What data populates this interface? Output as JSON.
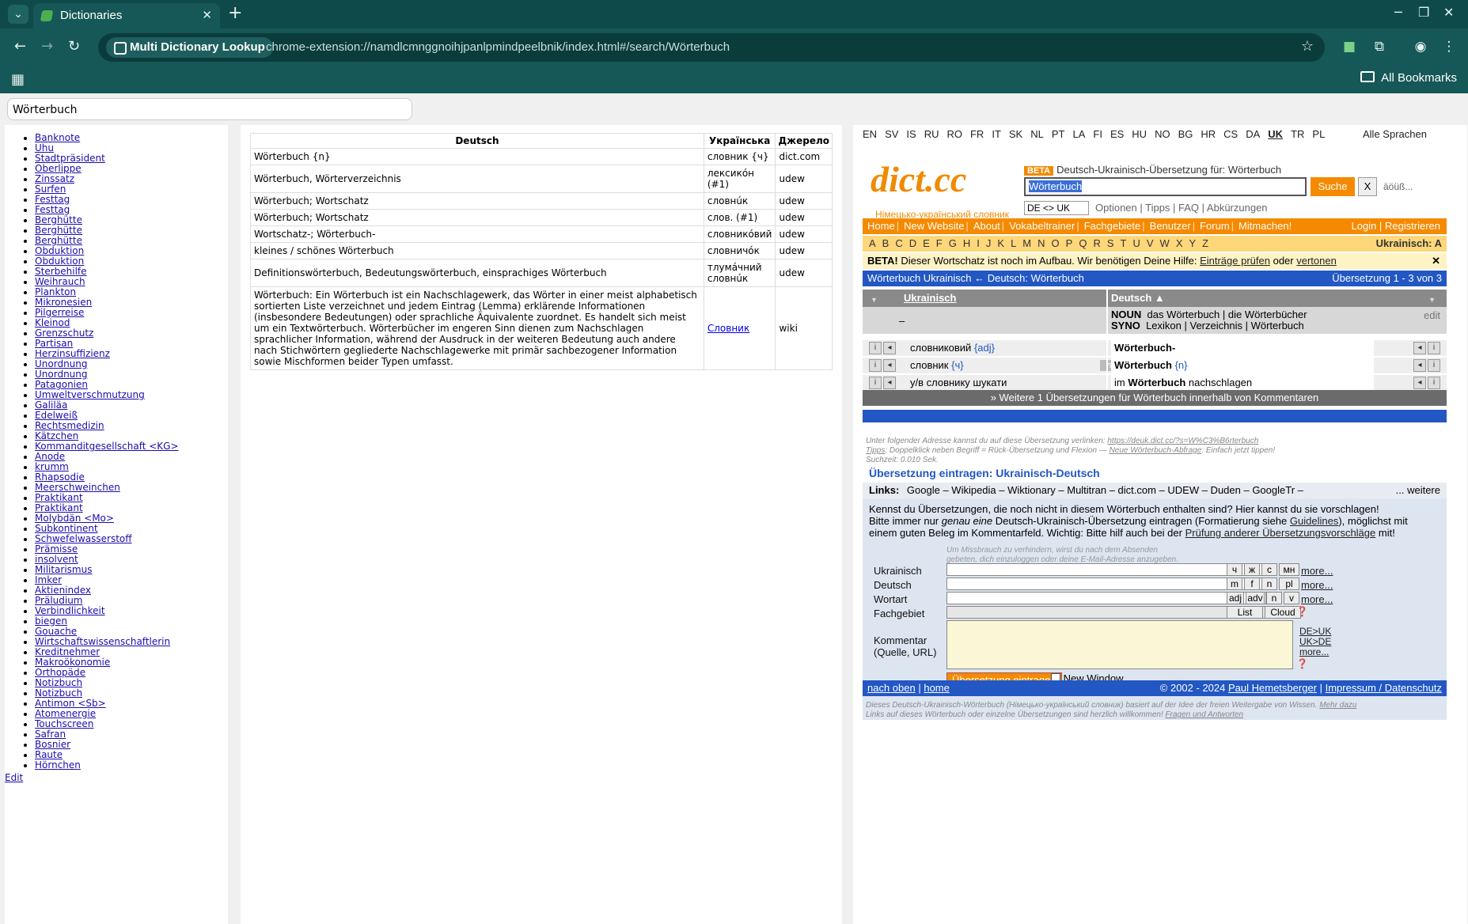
{
  "browser": {
    "tab_title": "Dictionaries",
    "site_name": "Multi Dictionary Lookup",
    "url": "chrome-extension://namdlcmnggnoihjpanlpmindpeelbnik/index.html#/search/Wörterbuch",
    "all_bookmarks": "All Bookmarks"
  },
  "search": {
    "value": "Wörterbuch"
  },
  "history": [
    "Banknote",
    "Uhu",
    "Stadtpräsident",
    "Oberlippe",
    "Zinssatz",
    "Surfen",
    "Festtag",
    "Festtag",
    "Berghütte",
    "Berghütte",
    "Berghütte",
    "Obduktion",
    "Obduktion",
    "Sterbehilfe",
    "Weihrauch",
    "Plankton",
    "Mikronesien",
    "Pilgerreise",
    "Kleinod",
    "Grenzschutz",
    "Partisan",
    "Herzinsuffizienz",
    "Unordnung",
    "Unordnung",
    "Patagonien",
    "Umweltverschmutzung",
    "Galiläa",
    "Edelweiß",
    "Rechtsmedizin",
    "Kätzchen",
    "Kommanditgesellschaft <KG>",
    "Anode",
    "krumm",
    "Rhapsodie",
    "Meerschweinchen",
    "Praktikant",
    "Praktikant",
    "Molybdän <Mo>",
    "Subkontinent",
    "Schwefelwasserstoff",
    "Prämisse",
    "insolvent",
    "Militarismus",
    "Imker",
    "Aktienindex",
    "Präludium",
    "Verbindlichkeit",
    "biegen",
    "Gouache",
    "Wirtschaftswissenschaftlerin",
    "Kreditnehmer",
    "Makroökonomie",
    "Orthopäde",
    "Notizbuch",
    "Notizbuch",
    "Antimon <Sb>",
    "Atomenergie",
    "Touchscreen",
    "Safran",
    "Bosnier",
    "Raute",
    "Hörnchen"
  ],
  "edit_label": "Edit",
  "results": {
    "headers": [
      "Deutsch",
      "Українська",
      "Джерело"
    ],
    "rows": [
      {
        "de": "Wörterbuch {n}",
        "uk": "словник {ч}",
        "src": "dict.com"
      },
      {
        "de": "Wörterbuch, Wörterverzeichnis",
        "uk": "лексикóн (#1)",
        "src": "udew"
      },
      {
        "de": "Wörterbuch; Wortschatz",
        "uk": "словнúк",
        "src": "udew"
      },
      {
        "de": "Wörterbuch; Wortschatz",
        "uk": "слов. (#1)",
        "src": "udew"
      },
      {
        "de": "Wortschatz-; Wörterbuch-",
        "uk": "словникóвий",
        "src": "udew"
      },
      {
        "de": "kleines / schönes Wörterbuch",
        "uk": "словничóк",
        "src": "udew"
      },
      {
        "de": "Definitionswörterbuch, Bedeutungswörterbuch, einsprachiges Wörterbuch",
        "uk": "тлумáчний словнúк",
        "src": "udew"
      },
      {
        "de": "Wörterbuch: Ein Wörterbuch ist ein Nachschlagewerk, das Wörter in einer meist alphabetisch sortierten Liste verzeichnet und jedem Eintrag (Lemma) erklärende Informationen (insbesondere Bedeutungen) oder sprachliche Äquivalente zuordnet. Es handelt sich meist um ein Textwörterbuch. Wörterbücher im engeren Sinn dienen zum Nachschlagen sprachlicher Information, während der Ausdruck in der weiteren Bedeutung auch andere nach Stichwörtern gegliederte Nachschlagewerke mit primär sachbezogener Information sowie Mischformen beider Typen umfasst.",
        "uk": "Словник",
        "src": "wiki"
      }
    ]
  },
  "dictcc": {
    "languages": [
      "EN",
      "SV",
      "IS",
      "RU",
      "RO",
      "FR",
      "IT",
      "SK",
      "NL",
      "PT",
      "LA",
      "FI",
      "ES",
      "HU",
      "NO",
      "BG",
      "HR",
      "CS",
      "DA",
      "UK",
      "TR",
      "PL"
    ],
    "selected_language": "UK",
    "all_languages": "Alle Sprachen",
    "logo": "dict.cc",
    "logo_sub": "Німецько-український словник",
    "beta_badge": "BETA",
    "beta_title": "Deutsch-Ukrainisch-Übersetzung für: Wörterbuch",
    "query": "Wörterbuch",
    "search_button": "Suche",
    "clear_button": "X",
    "special_chars": "äöüß...",
    "lang_select": "DE <> UK",
    "option_links": "Optionen | Tipps | FAQ | Abkürzungen",
    "menu": [
      "Home",
      "New Website",
      "About",
      "Vokabeltrainer",
      "Fachgebiete",
      "Benutzer",
      "Forum",
      "Mitmachen!"
    ],
    "menu_right": "Login | Registrieren",
    "alphabet": [
      "A",
      "B",
      "C",
      "D",
      "E",
      "F",
      "G",
      "H",
      "I",
      "J",
      "K",
      "L",
      "M",
      "N",
      "O",
      "P",
      "Q",
      "R",
      "S",
      "T",
      "U",
      "V",
      "W",
      "X",
      "Y",
      "Z"
    ],
    "alphabet_right": "Ukrainisch: A",
    "beta_note_bold": "BETA!",
    "beta_note": "Dieser Wortschatz ist noch im Aufbau. Wir benötigen Deine Hilfe:",
    "beta_link1": "Einträge prüfen",
    "beta_or": "oder",
    "beta_link2": "vertonen",
    "result_left": "Wörterbuch Ukrainisch ← Deutsch: Wörterbuch",
    "result_right": "Übersetzung 1 - 3 von 3",
    "col_uk": "Ukrainisch",
    "col_de": "Deutsch ▲",
    "noun_tag": "NOUN",
    "noun_text": "das Wörterbuch | die Wörterbücher",
    "syno_tag": "SYNO",
    "syno_text": "Lexikon | Verzeichnis | Wörterbuch",
    "edit": "edit",
    "dash": "–",
    "entries": [
      {
        "uk": "словниковий",
        "uk_tag": "{adj}",
        "badge": "",
        "de": "Wörterbuch-",
        "de_tag": ""
      },
      {
        "uk": "словник",
        "uk_tag": "{ч}",
        "badge": "лінгв.",
        "de": "Wörterbuch",
        "de_tag": "{n}"
      },
      {
        "uk": "у/в словнику шукати",
        "uk_tag": "",
        "badge": "",
        "de": "im Wörterbuch nachschlagen",
        "de_tag": ""
      }
    ],
    "more_translations": "» Weitere 1 Übersetzungen für Wörterbuch innerhalb von Kommentaren",
    "link_note": "Unter folgender Adresse kannst du auf diese Übersetzung verlinken:",
    "link_url": "https://deuk.dict.cc/?s=W%C3%B6rterbuch",
    "tips_label": "Tipps",
    "tips_text": ": Doppelklick neben Begriff = Rück-Übersetzung und Flexion —",
    "tips_link": "Neue Wörterbuch-Abfrage",
    "tips_end": ": Einfach jetzt tippen!",
    "search_time": "Suchzeit: 0.010 Sek.",
    "submit_title": "Übersetzung eintragen: Ukrainisch-Deutsch",
    "links_label": "Links:",
    "links": "Google – Wikipedia – Wiktionary – Multitran – dict.com – UDEW – Duden – GoogleTr –",
    "links_more": "... weitere",
    "intro1": "Kennst du Übersetzungen, die noch nicht in diesem Wörterbuch enthalten sind? Hier kannst du sie vorschlagen!",
    "intro2a": "Bitte immer nur",
    "intro2b": "genau eine",
    "intro2c": "Deutsch-Ukrainisch-Übersetzung eintragen (Formatierung siehe",
    "intro2link": "Guidelines",
    "intro2d": "), möglichst mit",
    "intro3a": "einem guten Beleg im Kommentarfeld. Wichtig: Bitte hilf auch bei der",
    "intro3link": "Prüfung anderer Übersetzungsvorschläge",
    "intro3b": "mit!",
    "abuse_note1": "Um Missbrauch zu verhindern, wirst du nach dem Absenden",
    "abuse_note2": "gebeten, dich einzuloggen oder deine E-Mail-Adresse anzugeben.",
    "form_labels": {
      "uk": "Ukrainisch",
      "de": "Deutsch",
      "wortart": "Wortart",
      "fach": "Fachgebiet",
      "komm1": "Kommentar",
      "komm2": "(Quelle, URL)"
    },
    "uk_buttons": [
      "ч",
      "ж",
      "с",
      "мн"
    ],
    "de_buttons": [
      "m",
      "f",
      "n",
      "pl"
    ],
    "wortart_buttons": [
      "adj",
      "adv",
      "n",
      "v"
    ],
    "fach_buttons": [
      "List",
      "Cloud"
    ],
    "more_link": "more...",
    "dir_links": [
      "DE>UK",
      "UK>DE",
      "more..."
    ],
    "submit_button": "Übersetzung eintragen",
    "new_window": "New Window",
    "footer_left1": "nach oben",
    "footer_left2": "home",
    "footer_right1": "© 2002 - 2024",
    "footer_right2": "Paul Hemetsberger",
    "footer_right3": "Impressum / Datenschutz",
    "bottom1a": "Dieses Deutsch-Ukrainisch-Wörterbuch (Німецько-український словник) basiert auf der Idee der freien Weitergabe von Wissen.",
    "bottom1link": "Mehr dazu",
    "bottom2a": "Links auf dieses Wörterbuch oder einzelne Übersetzungen sind herzlich willkommen!",
    "bottom2link": "Fragen und Antworten"
  }
}
